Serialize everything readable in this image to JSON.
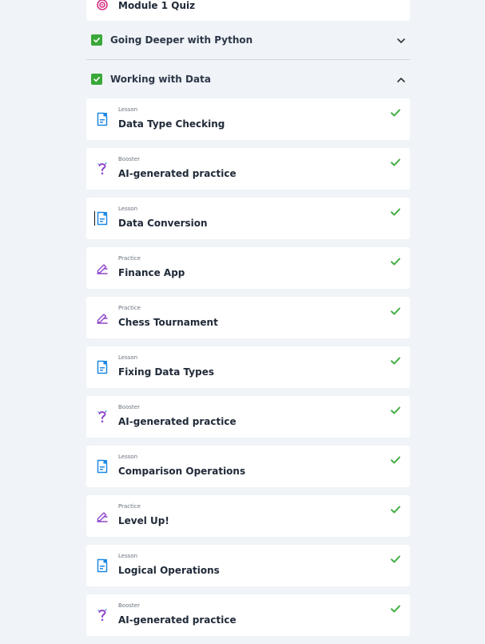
{
  "quiz_card": {
    "title": "Module 1 Quiz",
    "icon": "quiz-target-icon"
  },
  "sections": [
    {
      "label": "Going Deeper with Python",
      "completed": true,
      "expanded": false
    },
    {
      "label": "Working with Data",
      "completed": true,
      "expanded": true
    }
  ],
  "items": [
    {
      "type": "Lesson",
      "title": "Data Type Checking",
      "icon": "lesson-document-icon",
      "completed": true
    },
    {
      "type": "Booster",
      "title": "AI-generated practice",
      "icon": "question-mark-icon",
      "completed": true
    },
    {
      "type": "Lesson",
      "title": "Data Conversion",
      "icon": "lesson-document-icon",
      "completed": true
    },
    {
      "type": "Practice",
      "title": "Finance App",
      "icon": "pencil-icon",
      "completed": true
    },
    {
      "type": "Practice",
      "title": "Chess Tournament",
      "icon": "pencil-icon",
      "completed": true
    },
    {
      "type": "Lesson",
      "title": "Fixing Data Types",
      "icon": "lesson-document-icon",
      "completed": true
    },
    {
      "type": "Booster",
      "title": "AI-generated practice",
      "icon": "question-mark-icon",
      "completed": true
    },
    {
      "type": "Lesson",
      "title": "Comparison Operations",
      "icon": "lesson-document-icon",
      "completed": true
    },
    {
      "type": "Practice",
      "title": "Level Up!",
      "icon": "pencil-icon",
      "completed": true
    },
    {
      "type": "Lesson",
      "title": "Logical Operations",
      "icon": "lesson-document-icon",
      "completed": true
    },
    {
      "type": "Booster",
      "title": "AI-generated practice",
      "icon": "question-mark-icon",
      "completed": true
    }
  ],
  "colors": {
    "check_green": "#3fae3f",
    "checkbox_green": "#39a839",
    "lesson_blue": "#1e88e5",
    "practice_purple": "#8e44c9",
    "quiz_pink": "#d63384",
    "background": "#f0f3f7"
  }
}
